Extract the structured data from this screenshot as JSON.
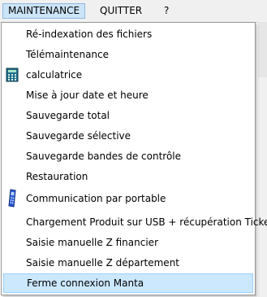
{
  "menubar": {
    "items": [
      {
        "label": "MAINTENANCE"
      },
      {
        "label": "QUITTER"
      },
      {
        "label": "?"
      }
    ]
  },
  "menu": {
    "items": [
      {
        "label": "Ré-indexation des fichiers"
      },
      {
        "label": "Télémaintenance"
      },
      {
        "label": "calculatrice",
        "icon": "calculator-icon"
      },
      {
        "label": "Mise à jour date et heure"
      },
      {
        "label": "Sauvegarde total"
      },
      {
        "label": "Sauvegarde sélective"
      },
      {
        "label": "Sauvegarde bandes de contrôle"
      },
      {
        "label": "Restauration"
      },
      {
        "label": "Communication par portable",
        "icon": "handheld-terminal-icon"
      },
      {
        "label": "Chargement Produit sur USB + récupération Tickets"
      },
      {
        "label": "Saisie manuelle Z financier"
      },
      {
        "label": "Saisie manuelle Z département"
      },
      {
        "label": "Ferme connexion Manta",
        "state": "highlighted"
      }
    ]
  },
  "colors": {
    "highlight_bg": "#cce8ff",
    "highlight_border": "#99d1ff",
    "menubar_active_bg": "#cce4f7"
  }
}
